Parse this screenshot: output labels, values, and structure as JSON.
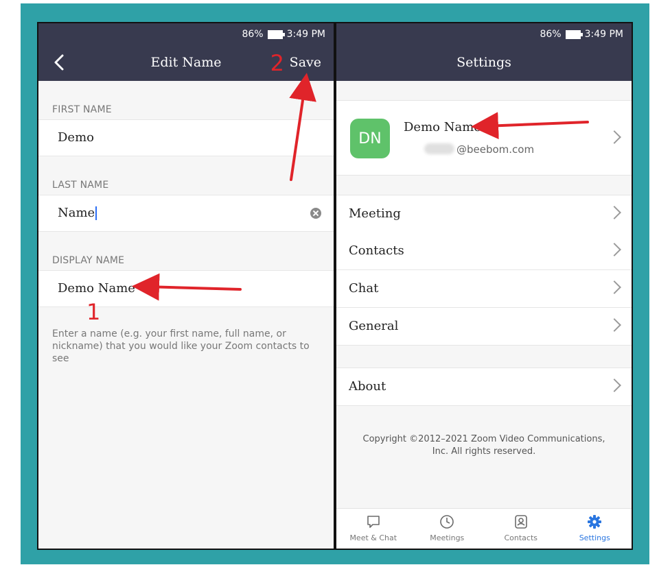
{
  "left": {
    "status": {
      "battery": "86%",
      "time": "3:49 PM"
    },
    "title": "Edit Name",
    "save_label": "Save",
    "first_name": {
      "label": "FIRST NAME",
      "value": "Demo"
    },
    "last_name": {
      "label": "LAST NAME",
      "value": "Name"
    },
    "display_name": {
      "label": "DISPLAY NAME",
      "value": "Demo Name"
    },
    "helper_text": "Enter a name (e.g. your first name, full name, or nickname) that you would like your Zoom contacts to see",
    "annotations": {
      "one": "1",
      "two": "2"
    }
  },
  "right": {
    "status": {
      "battery": "86%",
      "time": "3:49 PM"
    },
    "title": "Settings",
    "profile": {
      "initials": "DN",
      "name": "Demo Name",
      "email": "@beebom.com"
    },
    "menu": [
      "Meeting",
      "Contacts",
      "Chat",
      "General"
    ],
    "about": "About",
    "copyright": "Copyright ©2012–2021 Zoom Video Communications, Inc. All rights reserved.",
    "tabs": [
      {
        "label": "Meet & Chat",
        "icon": "chat-bubble-icon"
      },
      {
        "label": "Meetings",
        "icon": "clock-icon"
      },
      {
        "label": "Contacts",
        "icon": "contact-card-icon"
      },
      {
        "label": "Settings",
        "icon": "gear-icon"
      }
    ]
  },
  "colors": {
    "header": "#383a4f",
    "frame": "#2fa1a7",
    "accent": "#2a76e0",
    "annotation": "#e0242a",
    "avatar": "#5fc26a"
  }
}
